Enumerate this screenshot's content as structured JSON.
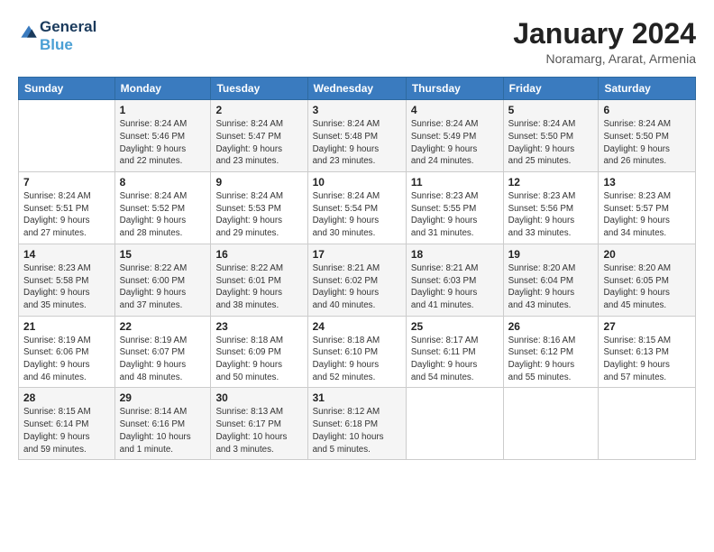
{
  "logo": {
    "line1": "General",
    "line2": "Blue"
  },
  "title": "January 2024",
  "location": "Noramarg, Ararat, Armenia",
  "days_header": [
    "Sunday",
    "Monday",
    "Tuesday",
    "Wednesday",
    "Thursday",
    "Friday",
    "Saturday"
  ],
  "weeks": [
    [
      {
        "day": "",
        "info": ""
      },
      {
        "day": "1",
        "info": "Sunrise: 8:24 AM\nSunset: 5:46 PM\nDaylight: 9 hours\nand 22 minutes."
      },
      {
        "day": "2",
        "info": "Sunrise: 8:24 AM\nSunset: 5:47 PM\nDaylight: 9 hours\nand 23 minutes."
      },
      {
        "day": "3",
        "info": "Sunrise: 8:24 AM\nSunset: 5:48 PM\nDaylight: 9 hours\nand 23 minutes."
      },
      {
        "day": "4",
        "info": "Sunrise: 8:24 AM\nSunset: 5:49 PM\nDaylight: 9 hours\nand 24 minutes."
      },
      {
        "day": "5",
        "info": "Sunrise: 8:24 AM\nSunset: 5:50 PM\nDaylight: 9 hours\nand 25 minutes."
      },
      {
        "day": "6",
        "info": "Sunrise: 8:24 AM\nSunset: 5:50 PM\nDaylight: 9 hours\nand 26 minutes."
      }
    ],
    [
      {
        "day": "7",
        "info": ""
      },
      {
        "day": "8",
        "info": "Sunrise: 8:24 AM\nSunset: 5:52 PM\nDaylight: 9 hours\nand 28 minutes."
      },
      {
        "day": "9",
        "info": "Sunrise: 8:24 AM\nSunset: 5:53 PM\nDaylight: 9 hours\nand 29 minutes."
      },
      {
        "day": "10",
        "info": "Sunrise: 8:24 AM\nSunset: 5:54 PM\nDaylight: 9 hours\nand 30 minutes."
      },
      {
        "day": "11",
        "info": "Sunrise: 8:23 AM\nSunset: 5:55 PM\nDaylight: 9 hours\nand 31 minutes."
      },
      {
        "day": "12",
        "info": "Sunrise: 8:23 AM\nSunset: 5:56 PM\nDaylight: 9 hours\nand 33 minutes."
      },
      {
        "day": "13",
        "info": "Sunrise: 8:23 AM\nSunset: 5:57 PM\nDaylight: 9 hours\nand 34 minutes."
      }
    ],
    [
      {
        "day": "14",
        "info": ""
      },
      {
        "day": "15",
        "info": "Sunrise: 8:22 AM\nSunset: 6:00 PM\nDaylight: 9 hours\nand 37 minutes."
      },
      {
        "day": "16",
        "info": "Sunrise: 8:22 AM\nSunset: 6:01 PM\nDaylight: 9 hours\nand 38 minutes."
      },
      {
        "day": "17",
        "info": "Sunrise: 8:21 AM\nSunset: 6:02 PM\nDaylight: 9 hours\nand 40 minutes."
      },
      {
        "day": "18",
        "info": "Sunrise: 8:21 AM\nSunset: 6:03 PM\nDaylight: 9 hours\nand 41 minutes."
      },
      {
        "day": "19",
        "info": "Sunrise: 8:20 AM\nSunset: 6:04 PM\nDaylight: 9 hours\nand 43 minutes."
      },
      {
        "day": "20",
        "info": "Sunrise: 8:20 AM\nSunset: 6:05 PM\nDaylight: 9 hours\nand 45 minutes."
      }
    ],
    [
      {
        "day": "21",
        "info": ""
      },
      {
        "day": "22",
        "info": "Sunrise: 8:19 AM\nSunset: 6:07 PM\nDaylight: 9 hours\nand 48 minutes."
      },
      {
        "day": "23",
        "info": "Sunrise: 8:18 AM\nSunset: 6:09 PM\nDaylight: 9 hours\nand 50 minutes."
      },
      {
        "day": "24",
        "info": "Sunrise: 8:18 AM\nSunset: 6:10 PM\nDaylight: 9 hours\nand 52 minutes."
      },
      {
        "day": "25",
        "info": "Sunrise: 8:17 AM\nSunset: 6:11 PM\nDaylight: 9 hours\nand 54 minutes."
      },
      {
        "day": "26",
        "info": "Sunrise: 8:16 AM\nSunset: 6:12 PM\nDaylight: 9 hours\nand 55 minutes."
      },
      {
        "day": "27",
        "info": "Sunrise: 8:15 AM\nSunset: 6:13 PM\nDaylight: 9 hours\nand 57 minutes."
      }
    ],
    [
      {
        "day": "28",
        "info": ""
      },
      {
        "day": "29",
        "info": "Sunrise: 8:14 AM\nSunset: 6:16 PM\nDaylight: 10 hours\nand 1 minute."
      },
      {
        "day": "30",
        "info": "Sunrise: 8:13 AM\nSunset: 6:17 PM\nDaylight: 10 hours\nand 3 minutes."
      },
      {
        "day": "31",
        "info": "Sunrise: 8:12 AM\nSunset: 6:18 PM\nDaylight: 10 hours\nand 5 minutes."
      },
      {
        "day": "",
        "info": ""
      },
      {
        "day": "",
        "info": ""
      },
      {
        "day": "",
        "info": ""
      }
    ]
  ],
  "week_sunday_info": [
    "Sunrise: 8:24 AM\nSunset: 5:51 PM\nDaylight: 9 hours\nand 27 minutes.",
    "Sunrise: 8:23 AM\nSunset: 5:58 PM\nDaylight: 9 hours\nand 35 minutes.",
    "Sunrise: 8:19 AM\nSunset: 6:06 PM\nDaylight: 9 hours\nand 46 minutes.",
    "Sunrise: 8:15 AM\nSunset: 6:14 PM\nDaylight: 9 hours\nand 59 minutes."
  ]
}
